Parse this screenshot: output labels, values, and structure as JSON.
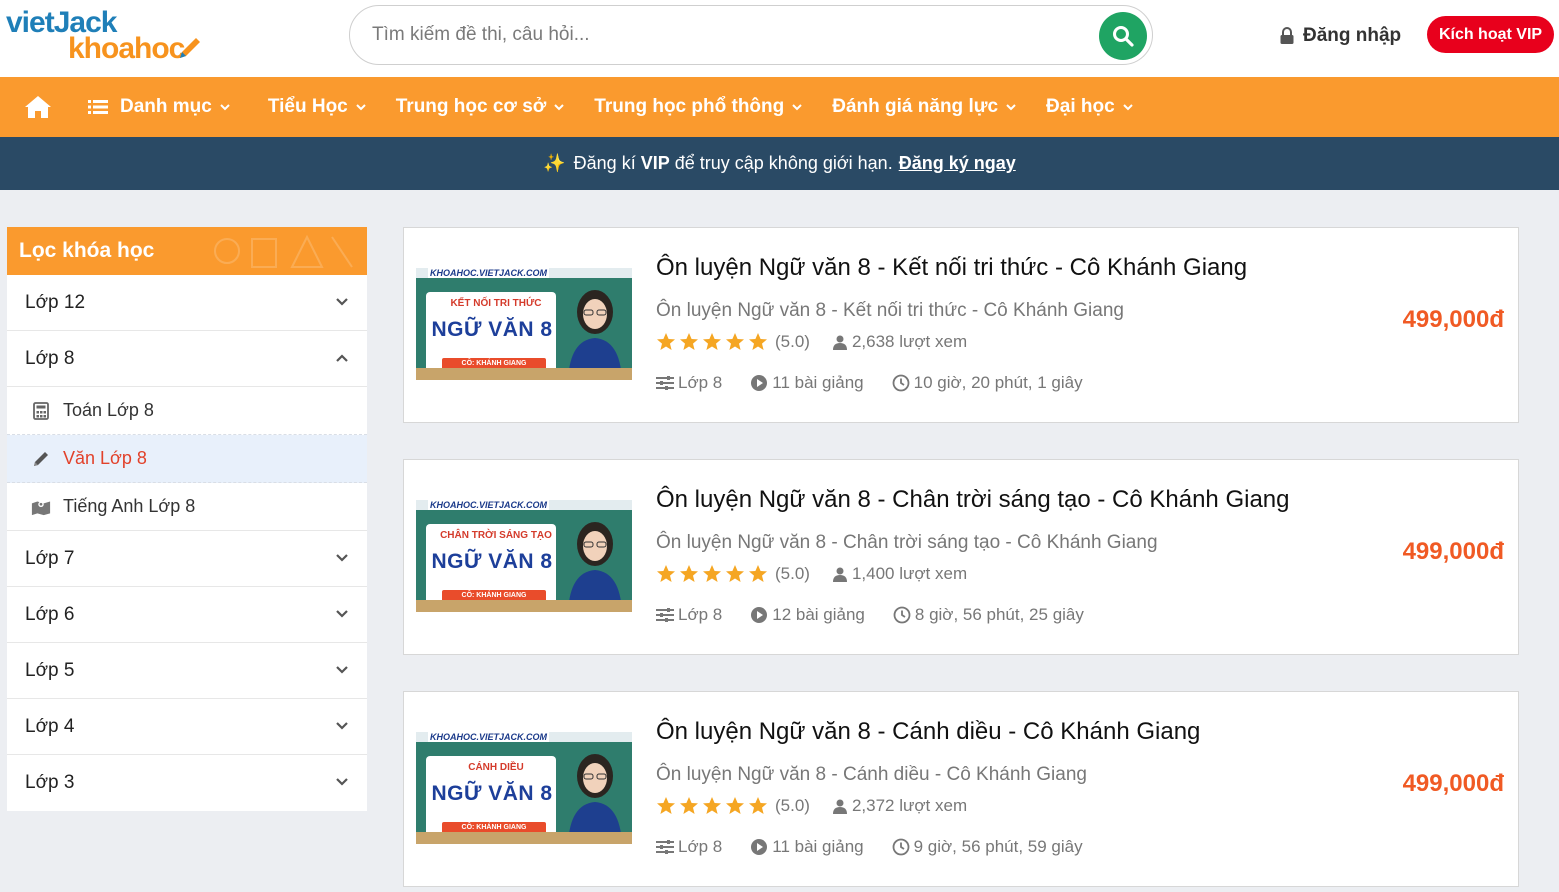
{
  "header": {
    "logo_top": "vietJack",
    "logo_bottom": "khoahoc",
    "search_placeholder": "Tìm kiếm đề thi, câu hỏi...",
    "login_label": "Đăng nhập",
    "vip_label": "Kích hoạt VIP",
    "colors": {
      "search_button": "#1fa463",
      "vip": "#e8001c"
    }
  },
  "nav": {
    "color": "#fa9a2e",
    "items": [
      {
        "label": "Danh mục"
      },
      {
        "label": "Tiểu Học"
      },
      {
        "label": "Trung học cơ sở"
      },
      {
        "label": "Trung học phổ thông"
      },
      {
        "label": "Đánh giá năng lực"
      },
      {
        "label": "Đại học"
      }
    ]
  },
  "banner": {
    "text_before": "Đăng kí",
    "vip": "VIP",
    "text_after": "để truy cập không giới hạn.",
    "link": "Đăng ký ngay"
  },
  "sidebar": {
    "title": "Lọc khóa học",
    "groups": [
      {
        "label": "Lớp 12",
        "expanded": false
      },
      {
        "label": "Lớp 8",
        "expanded": true
      },
      {
        "label": "Lớp 7",
        "expanded": false
      },
      {
        "label": "Lớp 6",
        "expanded": false
      },
      {
        "label": "Lớp 5",
        "expanded": false
      },
      {
        "label": "Lớp 4",
        "expanded": false
      },
      {
        "label": "Lớp 3",
        "expanded": false
      }
    ],
    "sub_items": [
      {
        "label": "Toán Lớp 8",
        "icon": "calculator-icon"
      },
      {
        "label": "Văn Lớp 8",
        "icon": "pencil-icon",
        "active": true
      },
      {
        "label": "Tiếng Anh Lớp 8",
        "icon": "map-icon"
      }
    ]
  },
  "courses": [
    {
      "title": "Ôn luyện Ngữ văn 8 - Kết nối tri thức - Cô Khánh Giang",
      "subtitle": "Ôn luyện Ngữ văn 8 - Kết nối tri thức - Cô Khánh Giang",
      "rating": "(5.0)",
      "views": "2,638 lượt xem",
      "grade": "Lớp 8",
      "lessons": "11 bài giảng",
      "duration": "10 giờ, 20 phút, 1 giây",
      "price": "499,000đ",
      "thumb": {
        "url": "KHOAHOC.VIETJACK.COM",
        "series": "KẾT NỐI TRI THỨC",
        "subject": "NGỮ VĂN 8",
        "teacher": "CÔ: KHÁNH GIANG"
      }
    },
    {
      "title": "Ôn luyện Ngữ văn 8 - Chân trời sáng tạo - Cô Khánh Giang",
      "subtitle": "Ôn luyện Ngữ văn 8 - Chân trời sáng tạo - Cô Khánh Giang",
      "rating": "(5.0)",
      "views": "1,400 lượt xem",
      "grade": "Lớp 8",
      "lessons": "12 bài giảng",
      "duration": "8 giờ, 56 phút, 25 giây",
      "price": "499,000đ",
      "thumb": {
        "url": "KHOAHOC.VIETJACK.COM",
        "series": "CHÂN TRỜI SÁNG TẠO",
        "subject": "NGỮ VĂN 8",
        "teacher": "CÔ: KHÁNH GIANG"
      }
    },
    {
      "title": "Ôn luyện Ngữ văn 8 - Cánh diều - Cô Khánh Giang",
      "subtitle": "Ôn luyện Ngữ văn 8 - Cánh diều - Cô Khánh Giang",
      "rating": "(5.0)",
      "views": "2,372 lượt xem",
      "grade": "Lớp 8",
      "lessons": "11 bài giảng",
      "duration": "9 giờ, 56 phút, 59 giây",
      "price": "499,000đ",
      "thumb": {
        "url": "KHOAHOC.VIETJACK.COM",
        "series": "CÁNH DIỀU",
        "subject": "NGỮ VĂN 8",
        "teacher": "CÔ: KHÁNH GIANG"
      }
    }
  ]
}
